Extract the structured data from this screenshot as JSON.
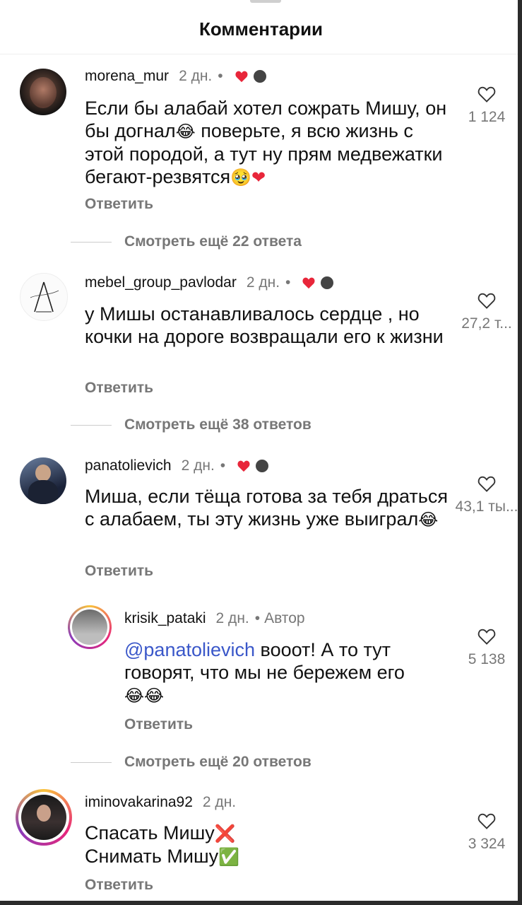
{
  "header": {
    "title": "Комментарии"
  },
  "comments": [
    {
      "username": "morena_mur",
      "time": "2 дн.",
      "text": "Если бы алабай хотел сожрать Мишу, он бы догнал",
      "text2": " поверьте, я всю жизнь с этой породой, а тут ну прям медвежатки бегают-резвятся",
      "reply": "Ответить",
      "likes": "1 124",
      "more": "Смотреть ещё 22 ответа"
    },
    {
      "username": "mebel_group_pavlodar",
      "time": "2 дн.",
      "text": "у Мишы останавливалось сердце , но кочки на дороге возвращали его к жизни",
      "reply": "Ответить",
      "likes": "27,2 т...",
      "more": "Смотреть ещё 38 ответов"
    },
    {
      "username": "panatolievich",
      "time": "2 дн.",
      "text": "Миша, если тёща готова за тебя драться с алабаем, ты эту жизнь уже выиграл",
      "reply": "Ответить",
      "likes": "43,1 ты...",
      "more": "Смотреть ещё 20 ответов"
    },
    {
      "username": "iminovakarina92",
      "time": "2 дн.",
      "line1": "Спасать Мишу",
      "line2": "Снимать Мишу",
      "reply": "Ответить",
      "likes": "3 324"
    }
  ],
  "nested_reply": {
    "username": "krisik_pataki",
    "time": "2 дн.",
    "author_label": "Автор",
    "mention": "@panatolievich",
    "text": " вооот! А то тут говорят, что мы не бережем его",
    "reply": "Ответить",
    "likes": "5 138"
  },
  "colors": {
    "heart_red": "#e8263a",
    "mention_blue": "#3a57c9",
    "muted_gray": "#777777"
  },
  "icons": [
    "heart-outline-icon",
    "heart-filled-icon",
    "laughing-emoji",
    "pleading-emoji",
    "red-heart-emoji",
    "cross-mark-emoji",
    "check-mark-emoji"
  ]
}
